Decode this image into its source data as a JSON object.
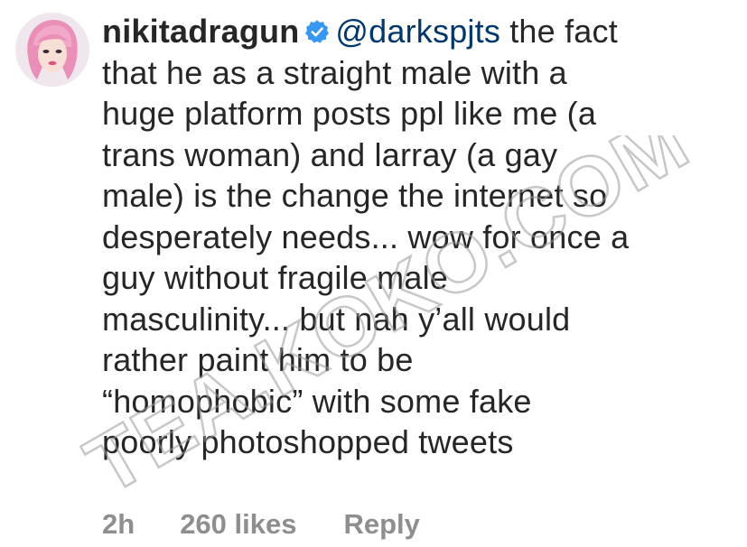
{
  "comment": {
    "username": "nikitadragun",
    "verified": true,
    "mention": "@darkspjts",
    "lines": [
      "the fact",
      "that he as a straight male with a",
      "huge platform posts ppl like me (a",
      "trans woman) and larray (a gay",
      "male) is the change the internet so",
      "desperately needs... wow for once a",
      "guy without fragile male",
      "masculinity... but nah y’all would",
      "rather paint him to be",
      "“homophobic” with some fake",
      "poorly photoshopped tweets"
    ],
    "time": "2h",
    "likes": "260 likes",
    "reply": "Reply"
  },
  "watermark": {
    "text": "TEA.KOKO.COM"
  },
  "colors": {
    "text": "#262626",
    "mention": "#00376b",
    "meta": "#8e8e8e",
    "verified": "#3897f0",
    "watermark": "#9a9a9a"
  },
  "icons": {
    "verified": "verified-badge-icon",
    "avatar": "profile-avatar"
  }
}
